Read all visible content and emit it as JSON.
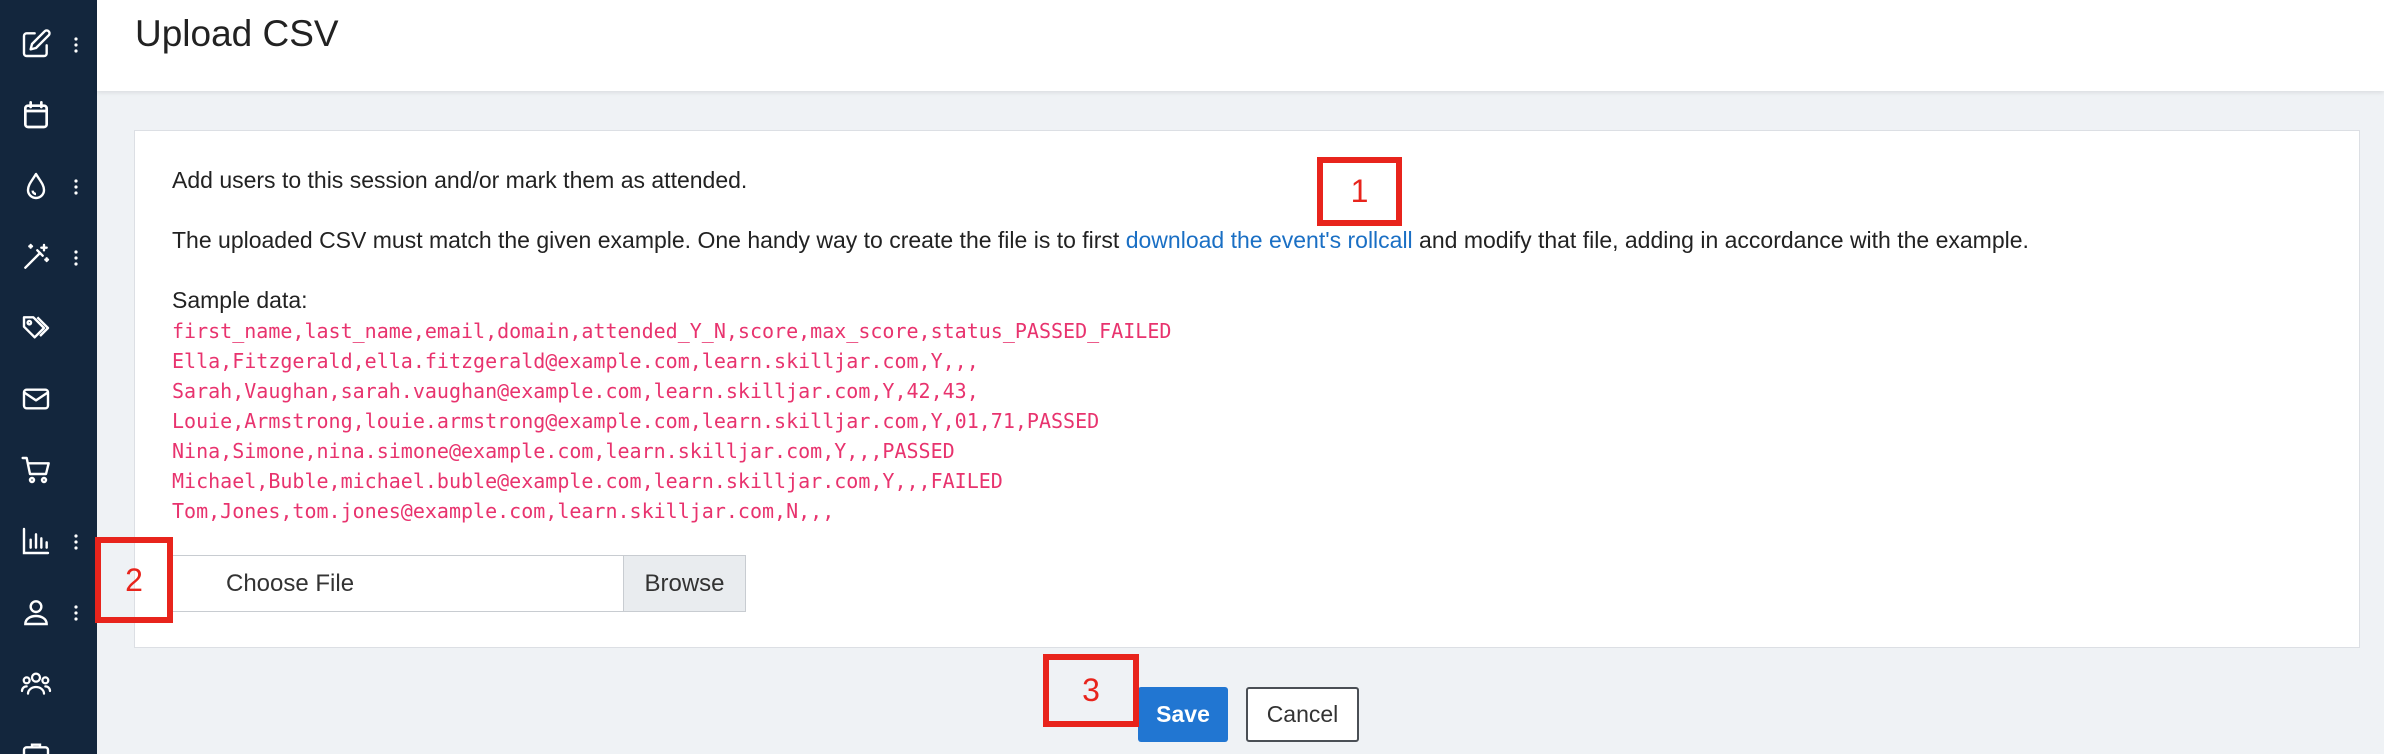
{
  "sidebar": {
    "items": [
      {
        "icon": "edit-icon",
        "has_menu": true
      },
      {
        "icon": "calendar-icon",
        "has_menu": false
      },
      {
        "icon": "drop-icon",
        "has_menu": true
      },
      {
        "icon": "magic-wand-icon",
        "has_menu": true
      },
      {
        "icon": "tags-icon",
        "has_menu": false
      },
      {
        "icon": "mail-icon",
        "has_menu": false
      },
      {
        "icon": "cart-icon",
        "has_menu": false
      },
      {
        "icon": "bar-chart-icon",
        "has_menu": true
      },
      {
        "icon": "user-icon",
        "has_menu": true
      },
      {
        "icon": "users-icon",
        "has_menu": false
      }
    ]
  },
  "header": {
    "title": "Upload CSV"
  },
  "card": {
    "intro": "Add users to this session and/or mark them as attended.",
    "instructions_before": "The uploaded CSV must match the given example. One handy way to create the file is to first ",
    "instructions_link": "download the event's rollcall",
    "instructions_after": " and modify that file, adding in accordance with the example.",
    "sample_label": "Sample data:",
    "sample_lines": [
      "first_name,last_name,email,domain,attended_Y_N,score,max_score,status_PASSED_FAILED",
      "Ella,Fitzgerald,ella.fitzgerald@example.com,learn.skilljar.com,Y,,,",
      "Sarah,Vaughan,sarah.vaughan@example.com,learn.skilljar.com,Y,42,43,",
      "Louie,Armstrong,louie.armstrong@example.com,learn.skilljar.com,Y,01,71,PASSED",
      "Nina,Simone,nina.simone@example.com,learn.skilljar.com,Y,,,PASSED",
      "Michael,Buble,michael.buble@example.com,learn.skilljar.com,Y,,,FAILED",
      "Tom,Jones,tom.jones@example.com,learn.skilljar.com,N,,,"
    ],
    "file_input": {
      "text": "Choose File",
      "browse_label": "Browse"
    }
  },
  "actions": {
    "save_label": "Save",
    "cancel_label": "Cancel"
  },
  "annotations": [
    "1",
    "2",
    "3"
  ],
  "colors": {
    "sidebar_bg": "#13263d",
    "link": "#1a6fc4",
    "code": "#e8336e",
    "primary": "#2176d2",
    "annotation": "#e8241c"
  }
}
